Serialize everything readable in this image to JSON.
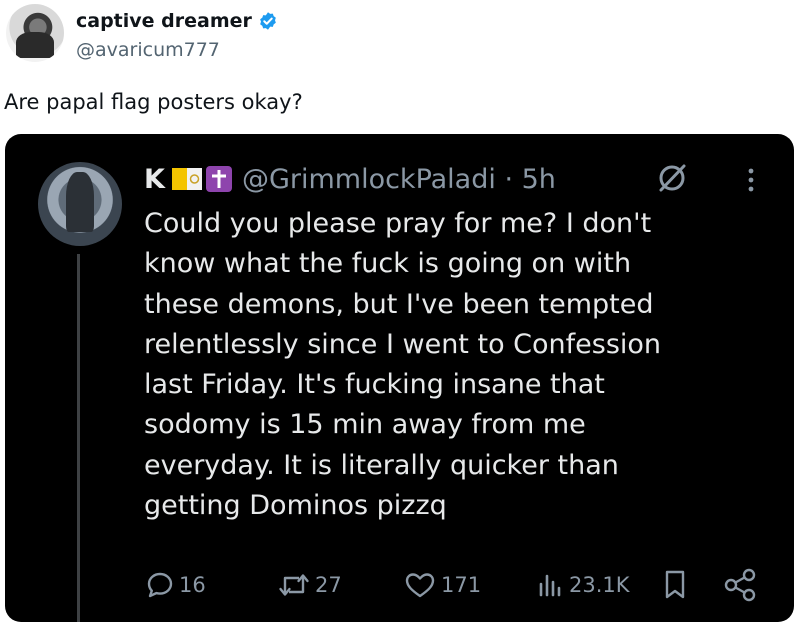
{
  "outer_tweet": {
    "display_name": "captive dreamer",
    "handle": "@avaricum777",
    "text": "Are papal flag posters okay?"
  },
  "quoted_tweet": {
    "display_name": "K",
    "handle_time": "@GrimmlockPaladi · 5h",
    "body": "Could you please pray for me? I don't\nknow what the fuck is going on with\nthese demons, but I've been tempted\nrelentlessly since I went to Confession\nlast Friday. It's fucking insane that\nsodomy is  15 min away from me\neveryday. It is literally quicker than\ngetting Dominos pizzq",
    "actions": {
      "replies": "16",
      "reposts": "27",
      "likes": "171",
      "views": "23.1K"
    }
  },
  "icons": [
    "verified-badge-icon",
    "papal-flag-icon",
    "cross-icon",
    "grok-icon",
    "more-icon",
    "reply-icon",
    "repost-icon",
    "like-icon",
    "views-icon",
    "bookmark-icon",
    "share-icon"
  ],
  "colors": {
    "verified": "#1d9bf0",
    "card_background": "#000000",
    "secondary_text": "#8b98a5",
    "cross_badge": "#8e44ad"
  }
}
